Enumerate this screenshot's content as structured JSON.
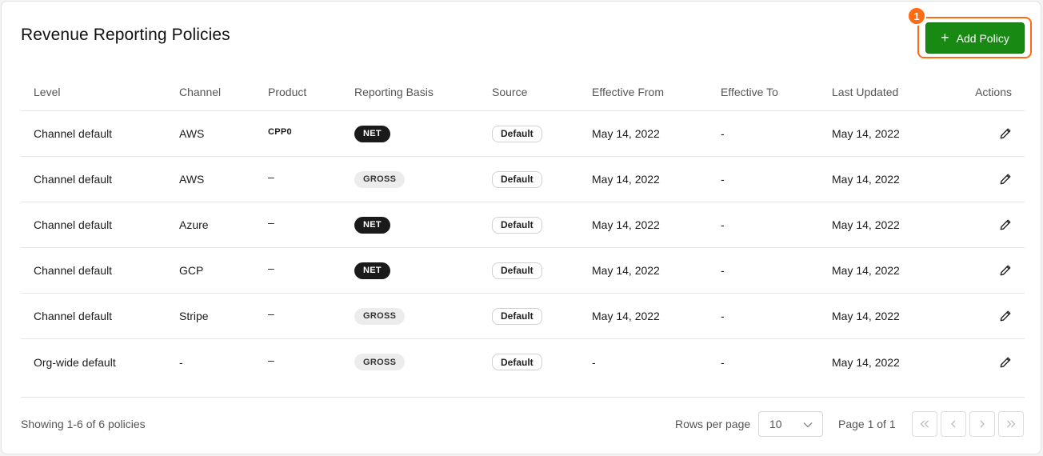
{
  "page": {
    "title": "Revenue Reporting Policies",
    "annotation_number": "1",
    "add_button_label": "Add Policy"
  },
  "table": {
    "headers": {
      "level": "Level",
      "channel": "Channel",
      "product": "Product",
      "basis": "Reporting Basis",
      "source": "Source",
      "from": "Effective From",
      "to": "Effective To",
      "updated": "Last Updated",
      "actions": "Actions"
    },
    "rows": [
      {
        "level": "Channel default",
        "channel": "AWS",
        "product": "CPP0",
        "basis": "NET",
        "source": "Default",
        "from": "May 14, 2022",
        "to": "-",
        "updated": "May 14, 2022"
      },
      {
        "level": "Channel default",
        "channel": "AWS",
        "product": "–",
        "basis": "GROSS",
        "source": "Default",
        "from": "May 14, 2022",
        "to": "-",
        "updated": "May 14, 2022"
      },
      {
        "level": "Channel default",
        "channel": "Azure",
        "product": "–",
        "basis": "NET",
        "source": "Default",
        "from": "May 14, 2022",
        "to": "-",
        "updated": "May 14, 2022"
      },
      {
        "level": "Channel default",
        "channel": "GCP",
        "product": "–",
        "basis": "NET",
        "source": "Default",
        "from": "May 14, 2022",
        "to": "-",
        "updated": "May 14, 2022"
      },
      {
        "level": "Channel default",
        "channel": "Stripe",
        "product": "–",
        "basis": "GROSS",
        "source": "Default",
        "from": "May 14, 2022",
        "to": "-",
        "updated": "May 14, 2022"
      },
      {
        "level": "Org-wide default",
        "channel": "-",
        "product": "–",
        "basis": "GROSS",
        "source": "Default",
        "from": "-",
        "to": "-",
        "updated": "May 14, 2022"
      }
    ]
  },
  "footer": {
    "showing": "Showing 1-6 of 6 policies",
    "rows_per_page_label": "Rows per page",
    "rows_per_page_value": "10",
    "page_info": "Page 1 of 1"
  },
  "colors": {
    "accent_green": "#188a14",
    "highlight_orange": "#ff6a13",
    "net_pill": "#1a1a1a",
    "gross_pill": "#ececec"
  },
  "icons": {
    "add": "plus-icon",
    "edit": "pencil-icon",
    "select": "chevron-down-icon",
    "first": "double-chevron-left-icon",
    "prev": "chevron-left-icon",
    "next": "chevron-right-icon",
    "last": "double-chevron-right-icon"
  }
}
